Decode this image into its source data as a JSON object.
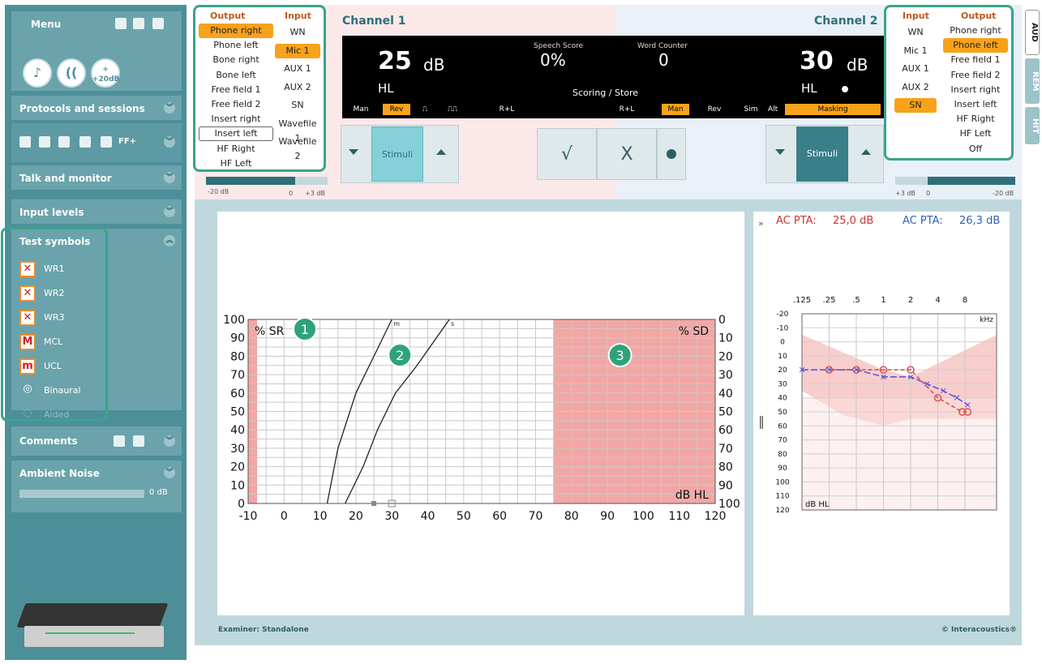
{
  "sidebar": {
    "menu_label": "Menu",
    "quick_buttons": [
      "music",
      "speech",
      "+20dB"
    ],
    "sections": {
      "protocols": "Protocols and sessions",
      "talk_monitor": "Talk and monitor",
      "input_levels": "Input levels",
      "test_symbols": "Test symbols",
      "comments": "Comments",
      "ambient_noise": "Ambient Noise"
    },
    "test_symbols": [
      {
        "label": "WR1",
        "glyph": "✕"
      },
      {
        "label": "WR2",
        "glyph": "✕"
      },
      {
        "label": "WR3",
        "glyph": "✕"
      },
      {
        "label": "MCL",
        "glyph": "M"
      },
      {
        "label": "UCL",
        "glyph": "m"
      },
      {
        "label": "Binaural",
        "glyph": "◎"
      },
      {
        "label": "Aided",
        "glyph": "◌"
      }
    ],
    "toolbar_ff_label": "FF+",
    "ambient_value": "0 dB"
  },
  "left_io": {
    "output_header": "Output",
    "input_header": "Input",
    "outputs": [
      "Phone right",
      "Phone left",
      "Bone right",
      "Bone left",
      "Free field 1",
      "Free field 2",
      "Insert right",
      "Insert left",
      "HF Right",
      "HF Left"
    ],
    "inputs": [
      "WN",
      "Mic 1",
      "AUX 1",
      "AUX 2",
      "SN",
      "Wavefile 1",
      "Wavefile 2"
    ]
  },
  "right_io": {
    "input_header": "Input",
    "output_header": "Output",
    "inputs": [
      "WN",
      "Mic 1",
      "AUX 1",
      "AUX 2",
      "SN"
    ],
    "outputs": [
      "Phone right",
      "Phone left",
      "Free field 1",
      "Free field 2",
      "Insert right",
      "Insert left",
      "HF Right",
      "HF Left",
      "Off"
    ]
  },
  "channel1": {
    "title": "Channel 1",
    "level": "25",
    "unit": "dB",
    "hl": "HL",
    "stim": "Stimuli"
  },
  "channel2": {
    "title": "Channel 2",
    "level": "30",
    "unit": "dB",
    "hl": "HL",
    "stim": "Stimuli"
  },
  "display": {
    "speech_score_label": "Speech Score",
    "speech_score": "0%",
    "word_counter_label": "Word Counter",
    "word_counter": "0",
    "scoring": "Scoring  /  Store",
    "strip_left": [
      "Man",
      "Rev",
      "⎍",
      "⎍⎍",
      "R+L"
    ],
    "strip_right": [
      "R+L",
      "Man",
      "Rev",
      "Sim",
      "Alt",
      "Masking"
    ]
  },
  "sliders": {
    "left": [
      "-20 dB",
      "0",
      "+3 dB"
    ],
    "right": [
      "+3 dB",
      "0",
      "-20 dB"
    ]
  },
  "speech_chart": {
    "left_axis": "% SR",
    "right_axis": "% SD",
    "unit_label": "dB HL",
    "x_ticks": [
      "-10",
      "0",
      "10",
      "20",
      "30",
      "40",
      "50",
      "60",
      "70",
      "80",
      "90",
      "100",
      "110",
      "120"
    ],
    "y_left": [
      "100",
      "90",
      "80",
      "70",
      "60",
      "50",
      "40",
      "30",
      "20",
      "10",
      "0"
    ],
    "y_right": [
      "0",
      "10",
      "20",
      "30",
      "40",
      "50",
      "60",
      "70",
      "80",
      "90",
      "100"
    ],
    "badges": [
      "1",
      "2",
      "3"
    ],
    "curve_labels": [
      "m",
      "s"
    ]
  },
  "audiogram": {
    "pta_left_label": "AC PTA:",
    "pta_left": "25,0 dB",
    "pta_right_label": "AC PTA:",
    "pta_right": "26,3 dB",
    "freqs": [
      ".125",
      ".25",
      ".5",
      "1",
      "2",
      "4",
      "8"
    ],
    "khz": "kHz",
    "levels": [
      "-20",
      "-10",
      "0",
      "10",
      "20",
      "30",
      "40",
      "50",
      "60",
      "70",
      "80",
      "90",
      "100",
      "110",
      "120"
    ],
    "unit_label": "dB HL"
  },
  "status": {
    "examiner": "Examiner: Standalone",
    "brand": "© Interacoustics®"
  },
  "tabs": [
    "AUD",
    "REM",
    "HIT"
  ],
  "colors": {
    "teal": "#4d8f99",
    "accent": "#f7a21b",
    "highlight": "#37a58a",
    "right_ear": "#d9534f",
    "left_ear": "#5a5ad6"
  }
}
